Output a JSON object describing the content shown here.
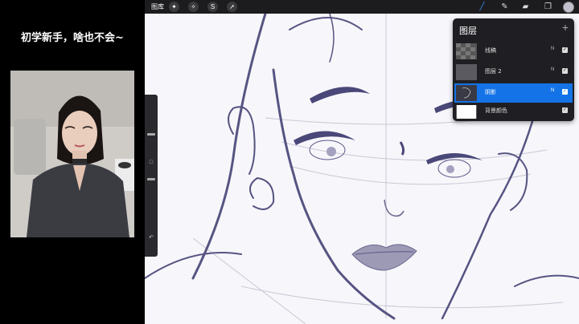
{
  "caption": "初学新手，啥也不会~",
  "procreate": {
    "gallery_label": "图库",
    "left_tools": [
      "wrench-icon",
      "magic-wand-icon",
      "selection-icon",
      "transform-icon"
    ],
    "right_tools": [
      "brush-icon",
      "smudge-icon",
      "eraser-icon",
      "layers-icon"
    ],
    "accent_color": "#1473e6",
    "layers_panel": {
      "title": "图层",
      "add_symbol": "+",
      "layers": [
        {
          "name": "线稿",
          "blend": "N",
          "visible": true,
          "active": false
        },
        {
          "name": "图层 2",
          "blend": "N",
          "visible": true,
          "active": false
        },
        {
          "name": "阴影",
          "blend": "N",
          "visible": true,
          "active": true
        },
        {
          "name": "背景颜色",
          "blend": "",
          "visible": true,
          "active": false
        }
      ]
    }
  }
}
